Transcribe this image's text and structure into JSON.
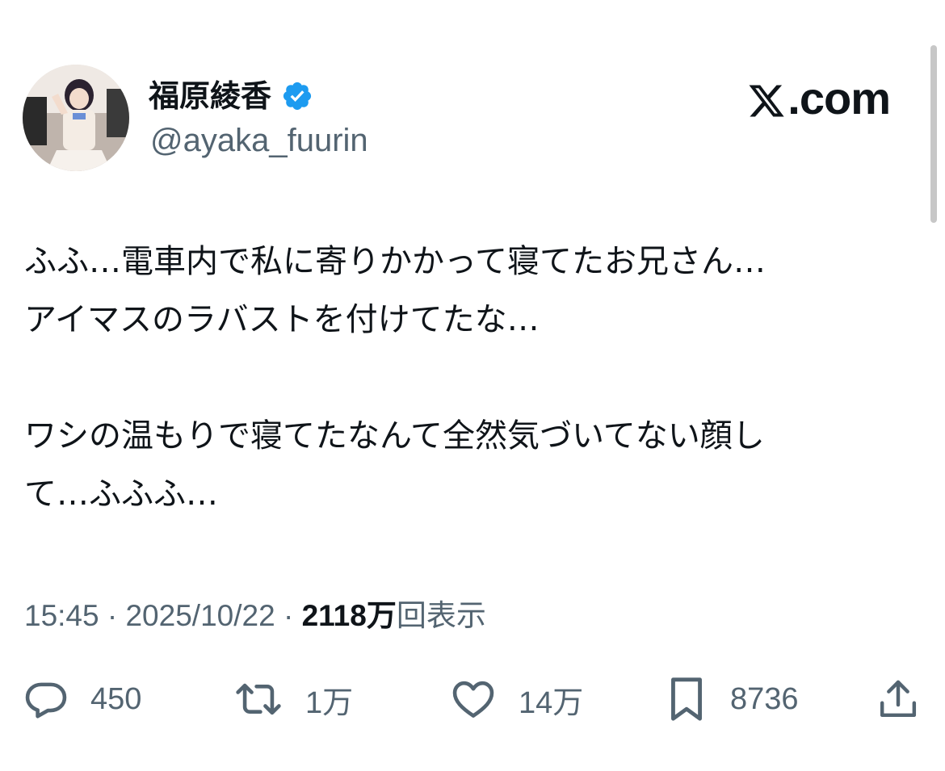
{
  "user": {
    "display_name": "福原綾香",
    "handle": "@ayaka_fuurin",
    "verified_icon": "verified-badge-icon"
  },
  "brand": {
    "label": ".com",
    "icon": "x-logo-icon"
  },
  "tweet": {
    "text": "ふふ…電車内で私に寄りかかって寝てたお兄さん…\nアイマスのラバストを付けてたな…\n\nワシの温もりで寝てたなんて全然気づいてない顔し\nて…ふふふ…"
  },
  "meta": {
    "time": "15:45",
    "separator": " · ",
    "date": "2025/10/22",
    "views_count": "2118万",
    "views_label": "回表示"
  },
  "actions": {
    "reply": {
      "icon": "reply-icon",
      "count": "450"
    },
    "retweet": {
      "icon": "retweet-icon",
      "count": "1万"
    },
    "like": {
      "icon": "like-icon",
      "count": "14万"
    },
    "bookmark": {
      "icon": "bookmark-icon",
      "count": "8736"
    },
    "share": {
      "icon": "share-icon"
    }
  },
  "colors": {
    "text": "#0f1419",
    "secondary": "#536471",
    "verified": "#1d9bf0"
  }
}
